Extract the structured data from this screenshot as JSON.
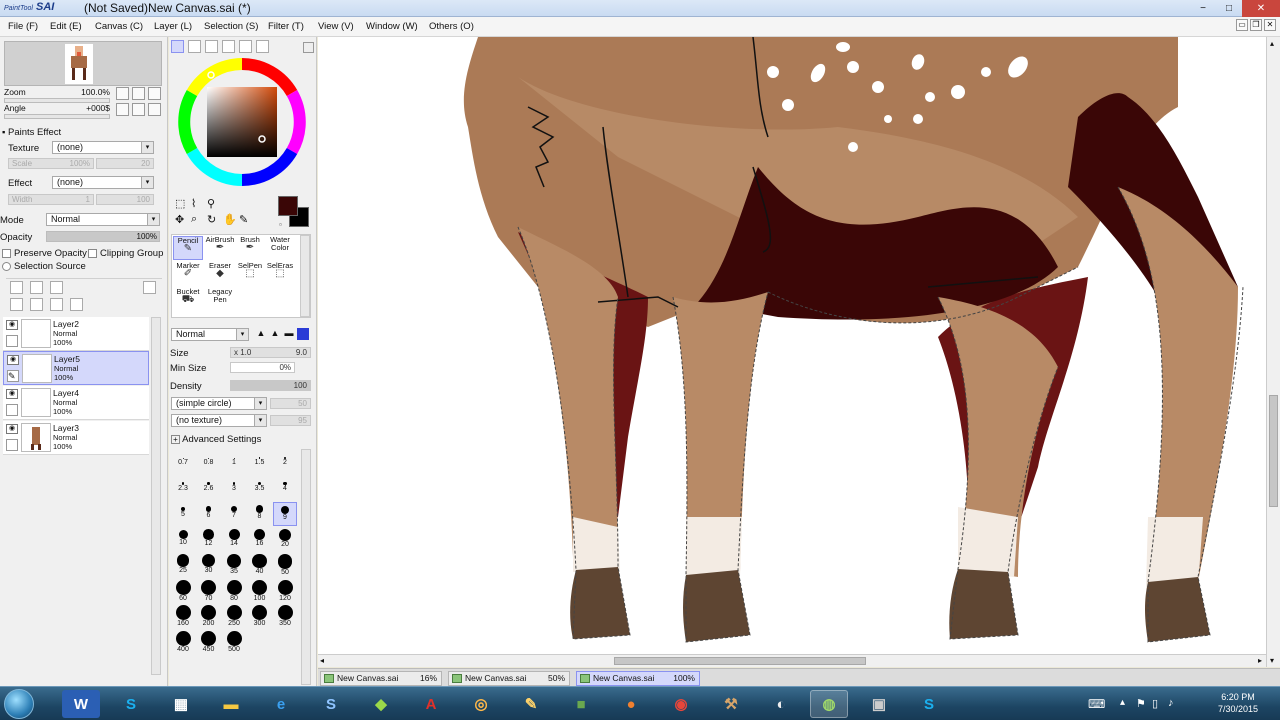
{
  "app": {
    "logo": "SAI",
    "logo_small": "PaintTool",
    "title": "(Not Saved)New Canvas.sai (*)"
  },
  "window_controls": {
    "minimize": "−",
    "maximize": "□",
    "close": "✕"
  },
  "menu": [
    "File (F)",
    "Edit (E)",
    "Canvas (C)",
    "Layer (L)",
    "Selection (S)",
    "Filter (T)",
    "View (V)",
    "Window (W)",
    "Others (O)"
  ],
  "navigator": {
    "zoom_label": "Zoom",
    "zoom_value": "100.0%",
    "angle_label": "Angle",
    "angle_value": "+000$"
  },
  "paints_effect": {
    "header": "Paints Effect",
    "texture_label": "Texture",
    "texture_value": "(none)",
    "scale_label": "Scale",
    "scale_value": "100%",
    "scale_num": "20",
    "effect_label": "Effect",
    "effect_value": "(none)",
    "width_label": "Width",
    "width_value": "1",
    "width_num": "100"
  },
  "layer_props": {
    "mode_label": "Mode",
    "mode_value": "Normal",
    "opacity_label": "Opacity",
    "opacity_value": "100%",
    "preserve_opacity": "Preserve Opacity",
    "clipping_group": "Clipping Group",
    "selection_source": "Selection Source"
  },
  "layers": [
    {
      "name": "Layer2",
      "mode": "Normal",
      "opacity": "100%",
      "selected": false
    },
    {
      "name": "Layer5",
      "mode": "Normal",
      "opacity": "100%",
      "selected": true
    },
    {
      "name": "Layer4",
      "mode": "Normal",
      "opacity": "100%",
      "selected": false
    },
    {
      "name": "Layer3",
      "mode": "Normal",
      "opacity": "100%",
      "selected": false
    }
  ],
  "colors": {
    "primary": "#3a0606",
    "secondary": "#000000",
    "accent_select": "#d4d8fb"
  },
  "tools": [
    {
      "name": "Pencil",
      "selected": true
    },
    {
      "name": "AirBrush",
      "selected": false
    },
    {
      "name": "Brush",
      "selected": false
    },
    {
      "name": "Water Color",
      "selected": false
    },
    {
      "name": "Marker",
      "selected": false
    },
    {
      "name": "Eraser",
      "selected": false
    },
    {
      "name": "SelPen",
      "selected": false
    },
    {
      "name": "SelEras",
      "selected": false
    },
    {
      "name": "Bucket",
      "selected": false
    },
    {
      "name": "Legacy Pen",
      "selected": false
    }
  ],
  "brush": {
    "blend_mode": "Normal",
    "size_label": "Size",
    "size_mult": "x 1.0",
    "size_value": "9.0",
    "min_size_label": "Min Size",
    "min_size_value": "0%",
    "density_label": "Density",
    "density_value": "100",
    "shape": "(simple circle)",
    "shape_num": "50",
    "texture": "(no texture)",
    "texture_num": "95",
    "advanced": "Advanced Settings"
  },
  "brush_sizes": [
    "0.7",
    "0.8",
    "1",
    "1.5",
    "2",
    "2.3",
    "2.6",
    "3",
    "3.5",
    "4",
    "5",
    "6",
    "7",
    "8",
    "9",
    "10",
    "12",
    "14",
    "16",
    "20",
    "25",
    "30",
    "35",
    "40",
    "50",
    "60",
    "70",
    "80",
    "100",
    "120",
    "160",
    "200",
    "250",
    "300",
    "350",
    "400",
    "450",
    "500"
  ],
  "selected_brush_size": "9",
  "doc_tabs": [
    {
      "name": "New Canvas.sai",
      "zoom": "16%",
      "selected": false
    },
    {
      "name": "New Canvas.sai",
      "zoom": "50%",
      "selected": false
    },
    {
      "name": "New Canvas.sai",
      "zoom": "100%",
      "selected": true
    }
  ],
  "taskbar": {
    "apps": [
      "start",
      "word",
      "skype",
      "film",
      "explorer",
      "ie",
      "stylus",
      "stack",
      "acrobat",
      "headphones",
      "pencil",
      "minecraft",
      "firefox",
      "chrome",
      "tools",
      "obs",
      "sai",
      "terminal",
      "skype2"
    ],
    "time": "6:20 PM",
    "date": "7/30/2015"
  }
}
